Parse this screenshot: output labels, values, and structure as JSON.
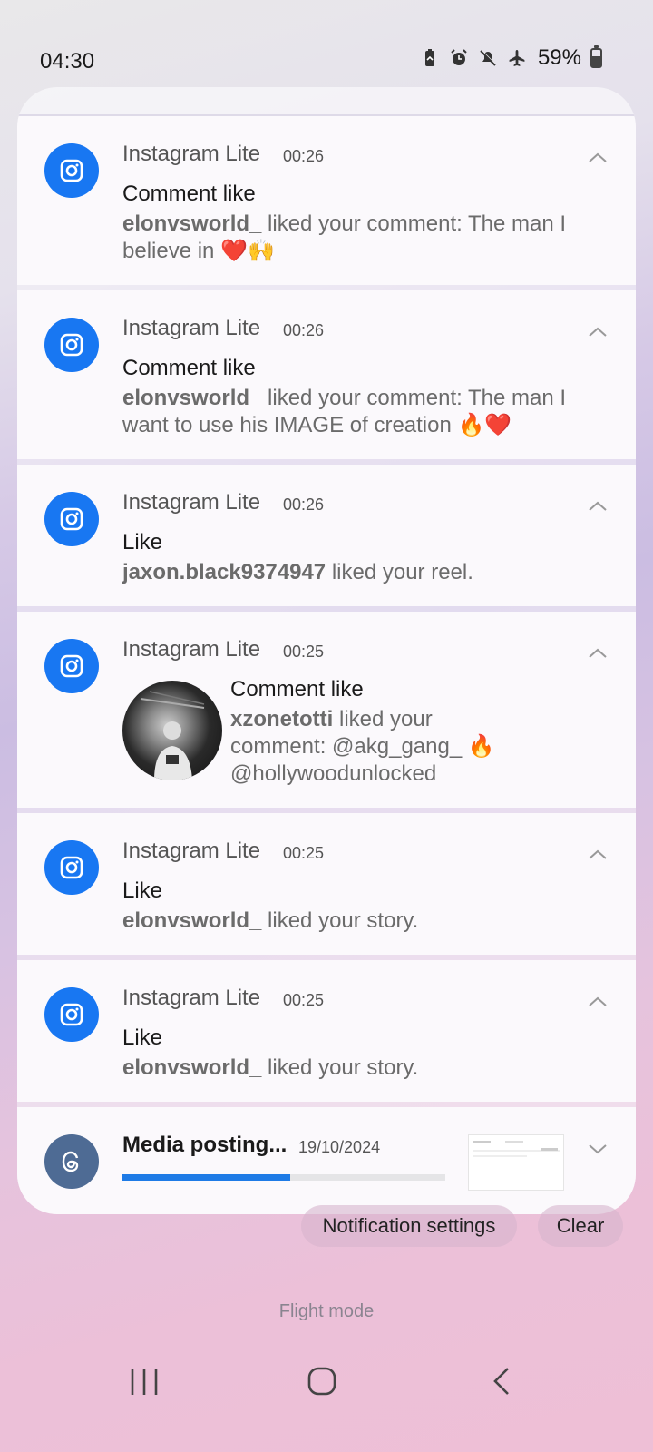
{
  "status_bar": {
    "time": "04:30",
    "battery_percent": "59%",
    "battery_level": 0.59,
    "icons": [
      "battery-saver-icon",
      "alarm-icon",
      "mute-icon",
      "airplane-icon"
    ]
  },
  "notifications": [
    {
      "app": "Instagram Lite",
      "time": "00:26",
      "title": "Comment like",
      "user": "elonvsworld_",
      "text": " liked your comment: The man I believe in ❤️🙌"
    },
    {
      "app": "Instagram Lite",
      "time": "00:26",
      "title": "Comment like",
      "user": "elonvsworld_",
      "text": " liked your comment: The man I want to use his IMAGE of creation 🔥❤️"
    },
    {
      "app": "Instagram Lite",
      "time": "00:26",
      "title": "Like",
      "user": "jaxon.black9374947",
      "text": " liked your reel."
    },
    {
      "app": "Instagram Lite",
      "time": "00:25",
      "title": "Comment like",
      "user": "xzonetotti",
      "text": " liked your comment: @akg_gang_ 🔥 @hollywoodunlocked"
    },
    {
      "app": "Instagram Lite",
      "time": "00:25",
      "title": "Like",
      "user": "elonvsworld_",
      "text": " liked your story."
    },
    {
      "app": "Instagram Lite",
      "time": "00:25",
      "title": "Like",
      "user": "elonvsworld_",
      "text": " liked your story."
    }
  ],
  "media_notification": {
    "title": "Media posting...",
    "date": "19/10/2024",
    "progress": 0.52
  },
  "buttons": {
    "notification_settings": "Notification settings",
    "clear": "Clear"
  },
  "footer": {
    "mode": "Flight mode"
  },
  "colors": {
    "instagram_blue": "#1877f2",
    "threads_blue": "#4e6b94",
    "progress_blue": "#1e7be6"
  }
}
